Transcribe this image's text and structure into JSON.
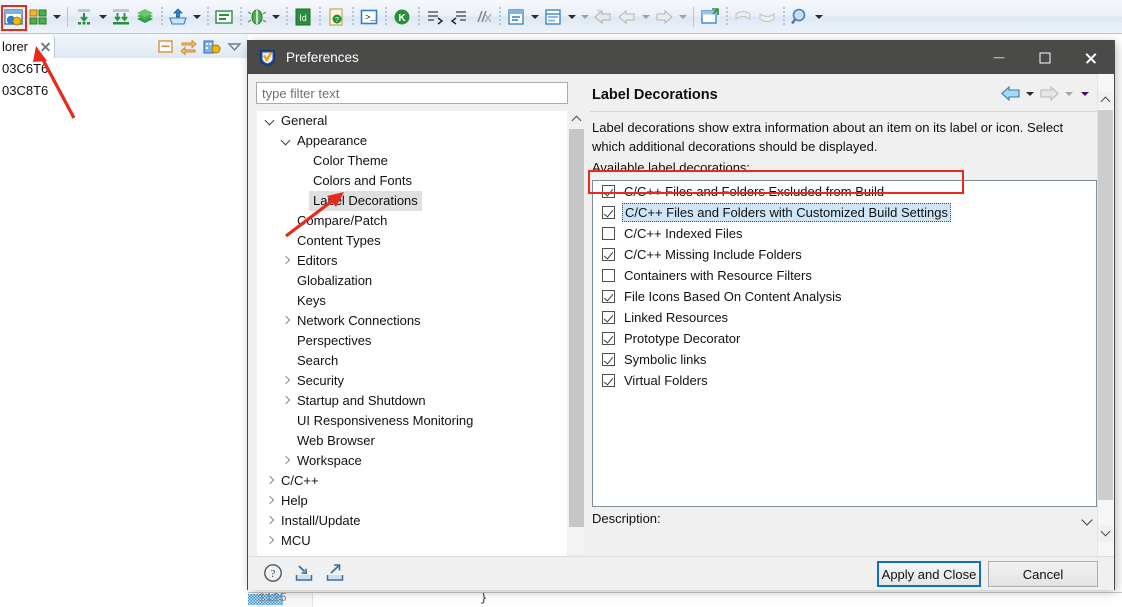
{
  "toolbar": {
    "icons": [
      {
        "name": "open-perspective-icon",
        "highlighted": true
      },
      {
        "name": "new-project-icon",
        "highlighted": false
      },
      {
        "name": "new-dropdown-caret",
        "highlighted": false
      },
      {
        "name": "build-all-icon",
        "highlighted": false
      },
      {
        "name": "build-dropdown-caret",
        "highlighted": false
      },
      {
        "name": "build-selected-icon",
        "highlighted": false
      },
      {
        "name": "books-icon",
        "highlighted": false
      },
      {
        "name": "save-icon",
        "highlighted": false
      },
      {
        "name": "save-dropdown-caret",
        "highlighted": false
      },
      {
        "name": "console-icon",
        "highlighted": false
      },
      {
        "name": "debug-icon",
        "highlighted": false
      },
      {
        "name": "debug-dropdown-caret",
        "highlighted": false
      },
      {
        "name": "id-editor-icon",
        "highlighted": false
      },
      {
        "name": "help-doc-icon",
        "highlighted": false
      },
      {
        "name": "terminal-icon",
        "highlighted": false
      },
      {
        "name": "kill-icon",
        "highlighted": false
      },
      {
        "name": "step-into-icon",
        "highlighted": false
      },
      {
        "name": "step-over-icon",
        "highlighted": false
      },
      {
        "name": "skip-breakpoints-icon",
        "highlighted": false
      },
      {
        "name": "open-type-icon",
        "highlighted": false
      },
      {
        "name": "open-type-caret",
        "highlighted": false
      },
      {
        "name": "open-resource-icon",
        "highlighted": false
      },
      {
        "name": "open-resource-caret",
        "highlighted": false
      },
      {
        "name": "back-history-icon",
        "highlighted": false
      },
      {
        "name": "back-nav-icon",
        "highlighted": false
      },
      {
        "name": "back-nav-caret",
        "highlighted": false
      },
      {
        "name": "forward-nav-icon",
        "highlighted": false
      },
      {
        "name": "forward-nav-caret",
        "highlighted": false
      },
      {
        "name": "new-window-icon",
        "highlighted": false
      },
      {
        "name": "previous-annotation-icon",
        "highlighted": false
      },
      {
        "name": "next-annotation-icon",
        "highlighted": false
      },
      {
        "name": "search-icon",
        "highlighted": false
      },
      {
        "name": "search-caret",
        "highlighted": false
      }
    ]
  },
  "explorer": {
    "tab_label": "lorer",
    "rows": [
      "03C6T6",
      "03C8T6"
    ],
    "view_tools": [
      "collapse-all-icon",
      "link-with-editor-icon",
      "view-menu-icon",
      "view-chevron-icon"
    ]
  },
  "editor": {
    "line_number": "1125",
    "code": "}"
  },
  "prefs": {
    "title": "Preferences",
    "window_buttons": [
      "minimize",
      "maximize",
      "close"
    ],
    "filter": {
      "placeholder": "type filter text",
      "value": ""
    },
    "tree": [
      {
        "label": "General",
        "indent": 0,
        "twisty": "expanded",
        "selected": false
      },
      {
        "label": "Appearance",
        "indent": 1,
        "twisty": "expanded",
        "selected": false
      },
      {
        "label": "Color Theme",
        "indent": 2,
        "twisty": "none",
        "selected": false
      },
      {
        "label": "Colors and Fonts",
        "indent": 2,
        "twisty": "none",
        "selected": false
      },
      {
        "label": "Label Decorations",
        "indent": 2,
        "twisty": "none",
        "selected": true
      },
      {
        "label": "Compare/Patch",
        "indent": 1,
        "twisty": "none",
        "selected": false
      },
      {
        "label": "Content Types",
        "indent": 1,
        "twisty": "none",
        "selected": false
      },
      {
        "label": "Editors",
        "indent": 1,
        "twisty": "collapsed",
        "selected": false
      },
      {
        "label": "Globalization",
        "indent": 1,
        "twisty": "none",
        "selected": false
      },
      {
        "label": "Keys",
        "indent": 1,
        "twisty": "none",
        "selected": false
      },
      {
        "label": "Network Connections",
        "indent": 1,
        "twisty": "collapsed",
        "selected": false
      },
      {
        "label": "Perspectives",
        "indent": 1,
        "twisty": "none",
        "selected": false
      },
      {
        "label": "Search",
        "indent": 1,
        "twisty": "none",
        "selected": false
      },
      {
        "label": "Security",
        "indent": 1,
        "twisty": "collapsed",
        "selected": false
      },
      {
        "label": "Startup and Shutdown",
        "indent": 1,
        "twisty": "collapsed",
        "selected": false
      },
      {
        "label": "UI Responsiveness Monitoring",
        "indent": 1,
        "twisty": "none",
        "selected": false
      },
      {
        "label": "Web Browser",
        "indent": 1,
        "twisty": "none",
        "selected": false
      },
      {
        "label": "Workspace",
        "indent": 1,
        "twisty": "collapsed",
        "selected": false
      },
      {
        "label": "C/C++",
        "indent": 0,
        "twisty": "collapsed",
        "selected": false
      },
      {
        "label": "Help",
        "indent": 0,
        "twisty": "collapsed",
        "selected": false
      },
      {
        "label": "Install/Update",
        "indent": 0,
        "twisty": "collapsed",
        "selected": false
      },
      {
        "label": "MCU",
        "indent": 0,
        "twisty": "collapsed",
        "selected": false
      }
    ],
    "page": {
      "title": "Label Decorations",
      "description": "Label decorations show extra information about an item on its label or icon. Select which additional decorations should be displayed.",
      "available_label": "Available label decorations:",
      "decorations": [
        {
          "label": "C/C++ Files and Folders Excluded from Build",
          "checked": true,
          "selected": false
        },
        {
          "label": "C/C++ Files and Folders with Customized Build Settings",
          "checked": true,
          "selected": true
        },
        {
          "label": "C/C++ Indexed Files",
          "checked": false,
          "selected": false
        },
        {
          "label": "C/C++ Missing Include Folders",
          "checked": true,
          "selected": false
        },
        {
          "label": "Containers with Resource Filters",
          "checked": false,
          "selected": false
        },
        {
          "label": "File Icons Based On Content Analysis",
          "checked": true,
          "selected": false
        },
        {
          "label": "Linked Resources",
          "checked": true,
          "selected": false
        },
        {
          "label": "Prototype Decorator",
          "checked": true,
          "selected": false
        },
        {
          "label": "Symbolic links",
          "checked": true,
          "selected": false
        },
        {
          "label": "Virtual Folders",
          "checked": true,
          "selected": false
        }
      ],
      "description_section_label": "Description:",
      "nav": [
        "back-arrow-icon",
        "back-caret-icon",
        "forward-arrow-icon",
        "forward-caret-icon",
        "page-menu-caret-icon"
      ]
    },
    "footer": {
      "icons": [
        "help-icon",
        "import-preferences-icon",
        "export-preferences-icon"
      ],
      "apply_label": "Apply and Close",
      "cancel_label": "Cancel"
    }
  },
  "annotations": {
    "highlight_color": "#e8291c",
    "arrows": [
      "toolbar-arrow",
      "tree-arrow"
    ]
  },
  "colors": {
    "titlebar": "#4a4a48",
    "dialog_bg": "#f0f0f0",
    "selection_blue": "#cde5f7",
    "accent_blue": "#0f6fc0"
  }
}
